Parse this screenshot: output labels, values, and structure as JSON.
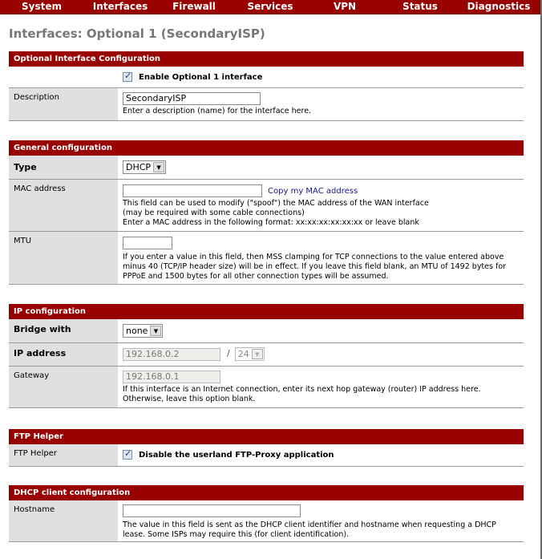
{
  "nav": [
    "System",
    "Interfaces",
    "Firewall",
    "Services",
    "VPN",
    "Status",
    "Diagnostics"
  ],
  "page_title": "Interfaces: Optional 1 (SecondaryISP)",
  "sections": {
    "optional": {
      "header": "Optional Interface Configuration",
      "enable_label": "Enable Optional 1 interface",
      "enable_checked": true,
      "description_label": "Description",
      "description_value": "SecondaryISP",
      "description_hint": "Enter a description (name) for the interface here."
    },
    "general": {
      "header": "General configuration",
      "type_label": "Type",
      "type_value": "DHCP",
      "mac_label": "MAC address",
      "mac_value": "",
      "mac_link": "Copy my MAC address",
      "mac_hint1": "This field can be used to modify (\"spoof\") the MAC address of the WAN interface",
      "mac_hint2": "(may be required with some cable connections)",
      "mac_hint3": "Enter a MAC address in the following format: xx:xx:xx:xx:xx:xx or leave blank",
      "mtu_label": "MTU",
      "mtu_value": "",
      "mtu_hint": "If you enter a value in this field, then MSS clamping for TCP connections to the value entered above minus 40 (TCP/IP header size) will be in effect. If you leave this field blank, an MTU of 1492 bytes for PPPoE and 1500 bytes for all other connection types will be assumed."
    },
    "ip": {
      "header": "IP configuration",
      "bridge_label": "Bridge with",
      "bridge_value": "none",
      "ip_label": "IP address",
      "ip_value": "192.168.0.2",
      "slash": "/",
      "subnet_value": "24",
      "gateway_label": "Gateway",
      "gateway_value": "192.168.0.1",
      "gateway_hint": "If this interface is an Internet connection, enter its next hop gateway (router) IP address here. Otherwise, leave this option blank."
    },
    "ftp": {
      "header": "FTP Helper",
      "label": "FTP Helper",
      "checkbox_label": "Disable the userland FTP-Proxy application",
      "checked": true
    },
    "dhcp": {
      "header": "DHCP client configuration",
      "hostname_label": "Hostname",
      "hostname_value": "",
      "hostname_hint": "The value in this field is sent as the DHCP client identifier and hostname when requesting a DHCP lease. Some ISPs may require this (for client identification)."
    }
  }
}
